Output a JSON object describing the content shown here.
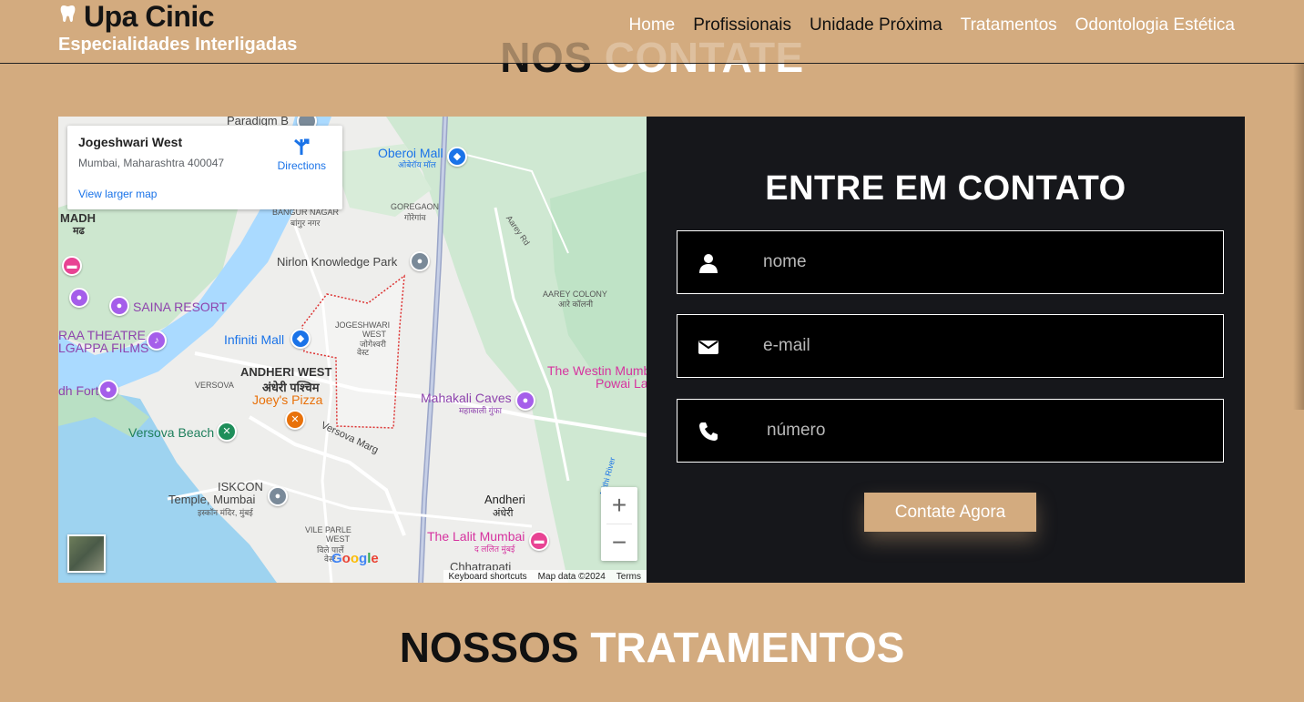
{
  "header": {
    "brand_title": "Upa Cinic",
    "brand_subtitle": "Especialidades Interligadas",
    "nav": [
      "Home",
      "Profissionais",
      "Unidade Próxima",
      "Tratamentos",
      "Odontologia Estética"
    ]
  },
  "contact_section": {
    "title_part1": "NOS",
    "title_part2": "CONTATE"
  },
  "map": {
    "place_name": "Jogeshwari West",
    "place_address": "Mumbai, Maharashtra 400047",
    "directions_label": "Directions",
    "larger_map_label": "View larger map",
    "labels": {
      "paradigm": "Paradigm B",
      "oberoi": "Oberoi Mall",
      "oberoi_hi": "ओबेरॉय मॉल",
      "madh": "MADH",
      "madh_hi": "मढ",
      "bangur": "BANGUR NAGAR",
      "bangur_hi": "बांगुर नगर",
      "goregaon": "GOREGAON",
      "goregaon_hi": "गोरेगांव",
      "aarey_rd": "Aarey Rd",
      "nirlon": "Nirlon Knowledge Park",
      "saina": "SAINA RESORT",
      "aarey_colony": "AAREY COLONY",
      "aarey_colony_hi": "आरे कॉलनी",
      "jogeshwari": "JOGESHWARI",
      "jogeshwari2": "WEST",
      "jogeshwari_hi": "जोगेश्वरी",
      "jogeshwari_hi2": "वेस्ट",
      "infiniti": "Infiniti Mall",
      "raa_theatre": "RAA THEATRE",
      "lgappa": "LGAPPA FILMS",
      "andheri_west": "ANDHERI WEST",
      "andheri_west_hi": "अंधेरी पश्चिम",
      "versova": "VERSOVA",
      "joeys": "Joey's Pizza",
      "westin": "The Westin Mumb",
      "powai": "Powai La",
      "dh_fort": "dh Fort",
      "mahakali": "Mahakali Caves",
      "mahakali_hi": "महाकाली गुंफा",
      "versova_beach": "Versova Beach",
      "versova_marg": "Versova Marg",
      "iskcon": "ISKCON",
      "iskcon2": "Temple, Mumbai",
      "iskcon_hi": "इस्कॉन मंदिर, मुंबई",
      "mithi": "Mithi River",
      "andheri": "Andheri",
      "andheri_hi": "अंधेरी",
      "vile_parle": "VILE PARLE",
      "vile_parle2": "WEST",
      "vile_parle_hi": "विले पार्ले",
      "vile_parle_hi2": "वेस्ट",
      "lalit": "The Lalit Mumbai",
      "lalit_hi": "द ललित मुंबई",
      "chhatrapati": "Chhatrapati",
      "google": "Google"
    },
    "zoom_in": "+",
    "zoom_out": "−",
    "attribution": [
      "Keyboard shortcuts",
      "Map data ©2024",
      "Terms"
    ]
  },
  "form": {
    "title": "ENTRE EM CONTATO",
    "name_placeholder": "nome",
    "email_placeholder": "e-mail",
    "phone_placeholder": "número",
    "submit_label": "Contate Agora"
  },
  "treatments_section": {
    "title_part1": "NOSSOS",
    "title_part2": "TRATAMENTOS"
  },
  "colors": {
    "background": "#d3ab7f",
    "panel": "#16171b",
    "accent": "#d3ab7f"
  }
}
